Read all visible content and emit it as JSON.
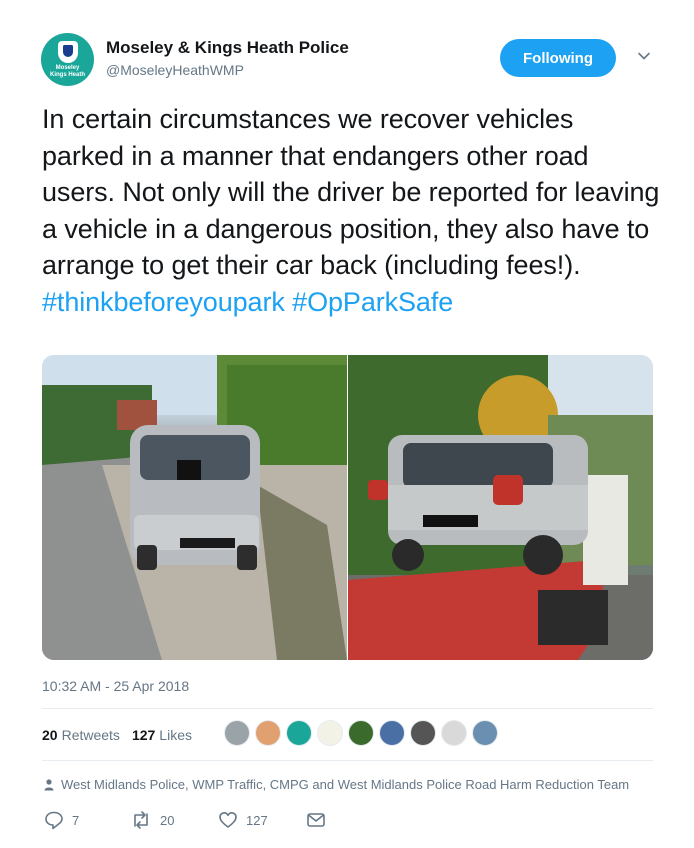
{
  "header": {
    "avatar_text_line1": "Moseley",
    "avatar_text_line2": "Kings Heath",
    "display_name": "Moseley & Kings Heath Police",
    "handle": "@MoseleyHeathWMP",
    "follow_label": "Following"
  },
  "tweet": {
    "text": "In certain circumstances we recover vehicles parked in a manner that endangers other road users. Not only will the driver be reported for leaving a vehicle in a dangerous position, they also have to arrange to get their car back (including fees!).",
    "hashtag1": "#thinkbeforeyoupark",
    "hashtag2": "#OpParkSafe"
  },
  "timestamp": "10:32 AM - 25 Apr 2018",
  "stats": {
    "retweets_count": "20",
    "retweets_label": "Retweets",
    "likes_count": "127",
    "likes_label": "Likes"
  },
  "likers": [
    {
      "color": "#9aa3a8"
    },
    {
      "color": "#e0a070"
    },
    {
      "color": "#1aa79a"
    },
    {
      "color": "#f2f2e6"
    },
    {
      "color": "#3b6b2c"
    },
    {
      "color": "#4a6fa5"
    },
    {
      "color": "#555555"
    },
    {
      "color": "#d9d9d9"
    },
    {
      "color": "#6a8fb0"
    }
  ],
  "attribution": "West Midlands Police, WMP Traffic, CMPG and West Midlands Police Road Harm Reduction Team",
  "actions": {
    "replies": "7",
    "retweets": "20",
    "likes": "127"
  },
  "colors": {
    "accent": "#1da1f2",
    "text": "#14171a",
    "muted": "#657786"
  },
  "icons": [
    "chevron-down-icon",
    "person-icon",
    "reply-icon",
    "retweet-icon",
    "heart-icon",
    "message-icon"
  ]
}
